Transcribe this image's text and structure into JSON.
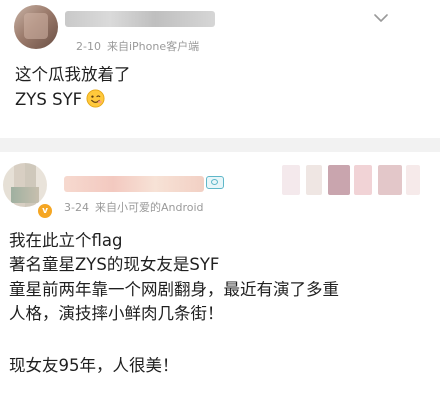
{
  "posts": [
    {
      "meta": {
        "date": "2-10",
        "source": "来自iPhone客户端"
      },
      "lines": [
        "这个瓜我放着了",
        "ZYS SYF"
      ],
      "emoji": "smiling-face-emoji",
      "icons": [
        "avatar-blurred",
        "chevron-down-icon"
      ]
    },
    {
      "meta": {
        "date": "3-24",
        "source": "来自小可爱的Android"
      },
      "lines": [
        "我在此立个flag",
        "著名童星ZYS的现女友是SYF",
        "童星前两年靠一个网剧翻身，最近有演了多重",
        "人格，演技摔小鲜肉几条街！",
        "现女友95年，人很美！"
      ],
      "icons": [
        "avatar-blurred",
        "verified-badge-icon",
        "vip-icon"
      ]
    }
  ],
  "colors": {
    "meta_text": "#9a9a9a",
    "body_text": "#1f1f1f",
    "separator": "#f2f2f2",
    "badge": "#f5a623",
    "vip": "#5fb7c9"
  }
}
